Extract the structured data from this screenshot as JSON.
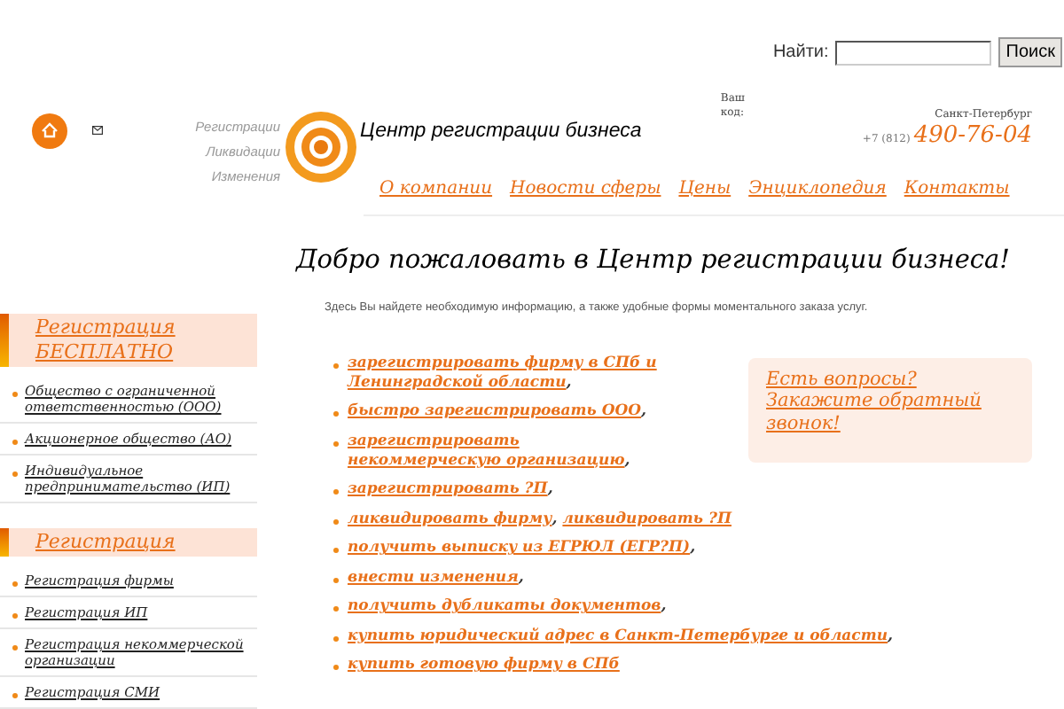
{
  "search": {
    "label": "Найти:",
    "button": "Поиск"
  },
  "header": {
    "taglines": [
      "Регистрации",
      "Ликвидации",
      "Изменения"
    ],
    "logo_text": "Центр регистрации бизнеса",
    "code_label": "Ваш код:",
    "city": "Санкт-Петербург",
    "phone_prefix": "+7 (812)",
    "phone": "490-76-04"
  },
  "nav": [
    "О компании",
    "Новости сферы",
    "Цены",
    "Энциклопедия",
    "Контакты"
  ],
  "sidebar": [
    {
      "title": "Регистрация БЕСПЛАТНО",
      "items": [
        "Общество с ограниченной ответственностью (ООО)",
        "Акционерное общество (АО)",
        "Индивидуальное предпринимательство (ИП)"
      ]
    },
    {
      "title": "Регистрация",
      "items": [
        "Регистрация фирмы",
        "Регистрация ИП",
        "Регистрация некоммерческой организации",
        "Регистрация СМИ"
      ]
    }
  ],
  "main": {
    "heading": "Добро пожаловать в Центр регистрации бизнеса!",
    "intro": "Здесь Вы найдете необходимую информацию, а также удобные формы моментального заказа услуг.",
    "services": [
      [
        {
          "kind": "link",
          "text": "зарегистрировать фирму в СПб и Ленинградской области"
        },
        {
          "kind": "text",
          "text": ","
        }
      ],
      [
        {
          "kind": "link",
          "text": "быстро зарегистрировать ООО"
        },
        {
          "kind": "text",
          "text": ","
        }
      ],
      [
        {
          "kind": "link",
          "text": "зарегистрировать некоммерческую организацию"
        },
        {
          "kind": "text",
          "text": ","
        }
      ],
      [
        {
          "kind": "link",
          "text": "зарегистрировать ?П"
        },
        {
          "kind": "text",
          "text": ","
        }
      ],
      [
        {
          "kind": "link",
          "text": "ликвидировать фирму"
        },
        {
          "kind": "text",
          "text": ","
        },
        {
          "kind": "link",
          "text": "ликвидировать ?П"
        }
      ],
      [
        {
          "kind": "link",
          "text": "получить выписку из ЕГРЮЛ (ЕГР?П)"
        },
        {
          "kind": "text",
          "text": ","
        }
      ],
      [
        {
          "kind": "link",
          "text": "внести изменения"
        },
        {
          "kind": "text",
          "text": ","
        }
      ],
      [
        {
          "kind": "link",
          "text": "получить дубликаты документов"
        },
        {
          "kind": "text",
          "text": ","
        }
      ],
      [
        {
          "kind": "link",
          "text": "купить юридический адрес в Санкт-Петербурге и области"
        },
        {
          "kind": "text",
          "text": ","
        }
      ],
      [
        {
          "kind": "link",
          "text": "купить готовую фирму в СПб"
        }
      ]
    ],
    "callback": "Есть вопросы? Закажите обратный звонок!"
  }
}
